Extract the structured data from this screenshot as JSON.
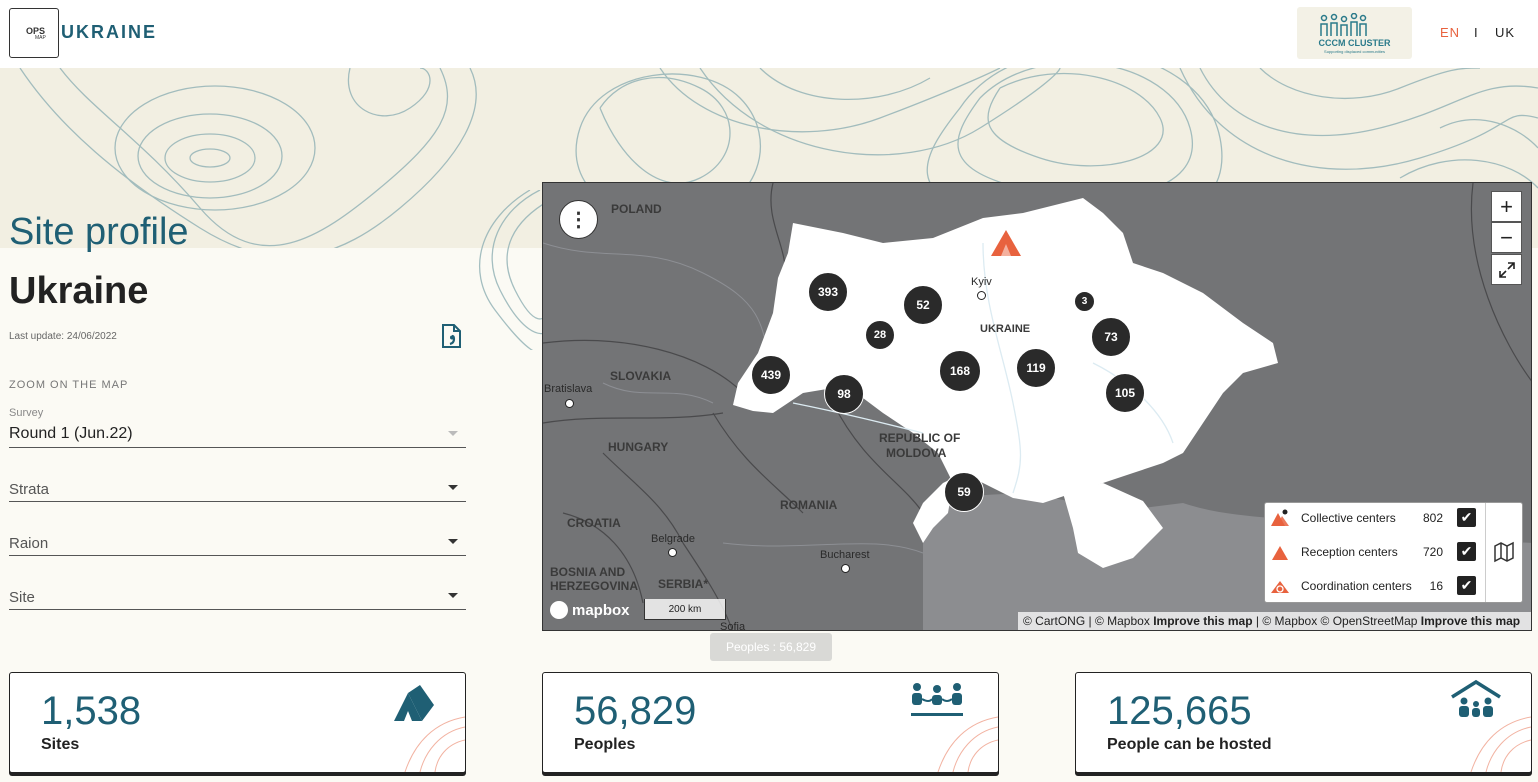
{
  "header": {
    "logo_ops": "OPS",
    "logo_map": "MAP",
    "logo_title": "UKRAINE",
    "partner_title": "CCCM CLUSTER",
    "partner_subtitle": "Supporting displaced communities",
    "lang_en": "EN",
    "lang_sep": "I",
    "lang_uk": "UK"
  },
  "profile": {
    "title": "Site profile",
    "country": "Ukraine",
    "last_update": "Last update: 24/06/2022",
    "zoom_label": "ZOOM ON THE MAP"
  },
  "filters": {
    "survey_label": "Survey",
    "survey_value": "Round 1 (Jun.22)",
    "strata_placeholder": "Strata",
    "raion_placeholder": "Raion",
    "site_placeholder": "Site"
  },
  "map": {
    "countries": {
      "poland": "POLAND",
      "slovakia": "SLOVAKIA",
      "hungary": "HUNGARY",
      "moldova_1": "REPUBLIC OF",
      "moldova_2": "MOLDOVA",
      "romania": "ROMANIA",
      "croatia": "CROATIA",
      "bosnia_1": "BOSNIA AND",
      "bosnia_2": "HERZEGOVINA",
      "serbia": "SERBIA*",
      "ukraine": "UKRAINE"
    },
    "cities": {
      "kyiv": "Kyiv",
      "bratislava": "Bratislava",
      "belgrade": "Belgrade",
      "bucharest": "Bucharest",
      "sofia": "Sofia"
    },
    "clusters": [
      "393",
      "52",
      "28",
      "3",
      "73",
      "439",
      "98",
      "168",
      "119",
      "105",
      "59"
    ],
    "zoom_in": "+",
    "zoom_out": "−",
    "menu": "⋮",
    "mapbox": "mapbox",
    "scale": "200 km",
    "attribution_1": "© CartONG | © Mapbox",
    "attribution_improve_1": "Improve this map",
    "attribution_2": "| © Mapbox © OpenStreetMap",
    "attribution_improve_2": "Improve this map",
    "tooltip": "Peoples : 56,829",
    "accent_color": "#e8623e"
  },
  "legend": {
    "items": [
      {
        "label": "Collective centers",
        "count": "802",
        "checked": true
      },
      {
        "label": "Reception centers",
        "count": "720",
        "checked": true
      },
      {
        "label": "Coordination centers",
        "count": "16",
        "checked": true
      }
    ]
  },
  "stats": [
    {
      "value": "1,538",
      "label": "Sites",
      "icon": "tents-icon"
    },
    {
      "value": "56,829",
      "label": "Peoples",
      "icon": "people-icon"
    },
    {
      "value": "125,665",
      "label": "People can be hosted",
      "icon": "shelter-people-icon"
    }
  ]
}
